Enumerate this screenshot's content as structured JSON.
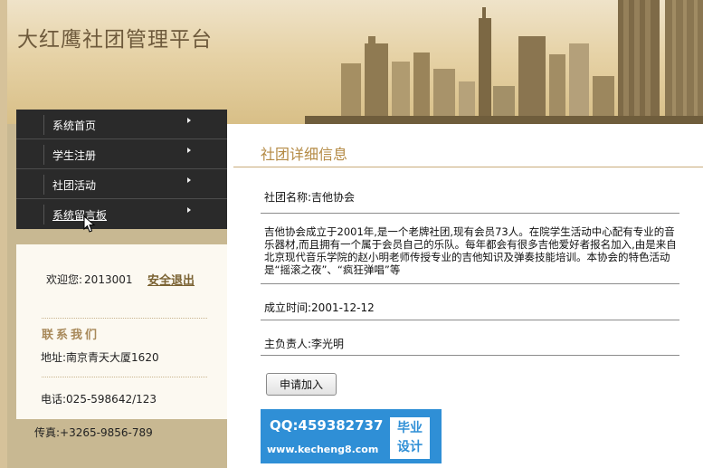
{
  "site": {
    "title": "大红鹰社团管理平台"
  },
  "nav": {
    "items": [
      {
        "label": "系统首页"
      },
      {
        "label": "学生注册"
      },
      {
        "label": "社团活动"
      },
      {
        "label": "系统留言板"
      }
    ]
  },
  "user_panel": {
    "welcome_label": "欢迎您:",
    "username": "2013001",
    "logout_label": "安全退出"
  },
  "contact": {
    "title": "联系我们",
    "address": "地址:南京青天大厦1620",
    "phone": "电话:025-598642/123",
    "fax": "传真:+3265-9856-789"
  },
  "main": {
    "title": "社团详细信息",
    "club_name": "社团名称:吉他协会",
    "description": "吉他协会成立于2001年,是一个老牌社团,现有会员73人。在院学生活动中心配有专业的音乐器材,而且拥有一个属于会员自己的乐队。每年都会有很多吉他爱好者报名加入,由是来自北京现代音乐学院的赵小明老师传授专业的吉他知识及弹奏技能培训。本协会的特色活动是“摇滚之夜”、“疯狂弹唱”等",
    "founded": "成立时间:2001-12-12",
    "leader": "主负责人:李光明",
    "apply_label": "申请加入"
  },
  "watermark": {
    "qq": "QQ:459382737",
    "site": "www.kecheng8.com",
    "badge_line1": "毕业",
    "badge_line2": "设计"
  },
  "colors": {
    "header_bg": "#e6d2a6",
    "nav_bg": "#2a2a2a",
    "accent": "#b48a44",
    "sidebar_bg": "#c8b892",
    "watermark_bg": "#2f8fd6"
  }
}
